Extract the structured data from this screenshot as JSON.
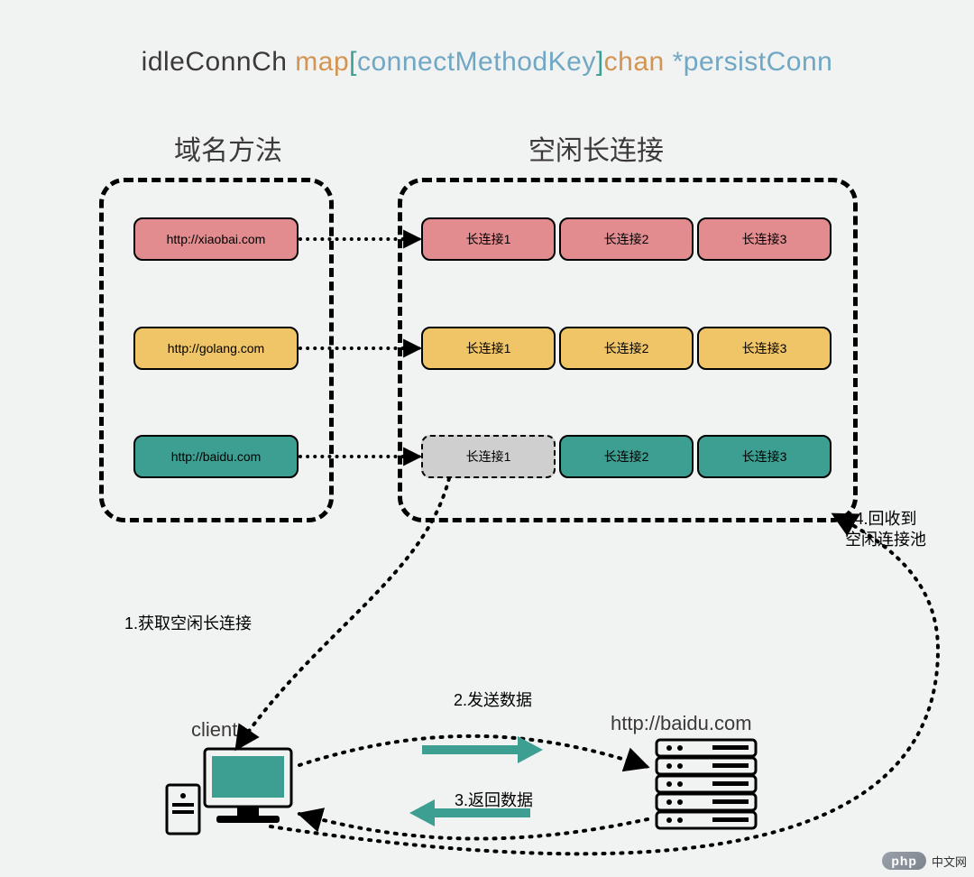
{
  "title": {
    "idleConnCh": "idleConnCh",
    "map": "map",
    "lbr": "[",
    "key": "connectMethodKey",
    "rbr": "]",
    "chan": "chan",
    "star": "*",
    "persistConn": "persistConn"
  },
  "headings": {
    "domain": "域名方法",
    "idle": "空闲长连接"
  },
  "domains": [
    "http://xiaobai.com",
    "http://golang.com",
    "http://baidu.com"
  ],
  "rows": [
    {
      "cells": [
        "长连接1",
        "长连接2",
        "长连接3"
      ],
      "style": "pink"
    },
    {
      "cells": [
        "长连接1",
        "长连接2",
        "长连接3"
      ],
      "style": "yellow"
    },
    {
      "cells": [
        "长连接1",
        "长连接2",
        "长连接3"
      ],
      "style": "teal",
      "first_dashed": true
    }
  ],
  "steps": {
    "s1": "1.获取空闲长连接",
    "s2": "2.发送数据",
    "s3": "3.返回数据",
    "s4a": "4.回收到",
    "s4b": "空闲连接池"
  },
  "labels": {
    "client": "client",
    "server": "http://baidu.com"
  },
  "watermark": {
    "logo": "php",
    "text": "中文网"
  }
}
